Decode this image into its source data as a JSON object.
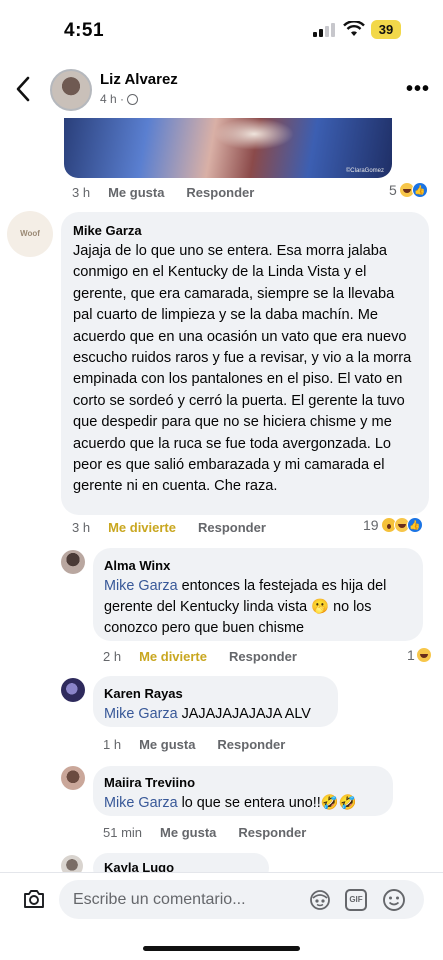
{
  "status_bar": {
    "time": "4:51",
    "battery": "39"
  },
  "header": {
    "name": "Liz Alvarez",
    "meta": "4 h ·"
  },
  "top_comment": {
    "image_credit": "©ClaraGomez",
    "time": "3 h",
    "like": "Me gusta",
    "reply": "Responder",
    "reaction_count": "5"
  },
  "main_comment": {
    "avatar_text": "Woof",
    "name": "Mike Garza",
    "text": "Jajaja de lo que uno se entera. Esa morra jalaba conmigo en el Kentucky de la Linda Vista y el gerente, que era camarada, siempre se la llevaba pal cuarto de limpieza y se la daba machín. Me acuerdo que en una ocasión un vato que era nuevo escucho ruidos raros y fue a revisar, y vio a la morra empinada con los pantalones en el piso. El vato en corto se sordeó y cerró la puerta. El gerente la tuvo que despedir para que no se hiciera chisme y me acuerdo que la ruca se fue toda avergonzada. Lo peor es que salió embarazada y mi camarada el gerente ni en cuenta. Che raza.",
    "time": "3 h",
    "reaction": "Me divierte",
    "reply": "Responder",
    "reaction_count": "19"
  },
  "replies": [
    {
      "name": "Alma Winx",
      "mention": "Mike Garza",
      "text": " entonces la festejada es hija del gerente del Kentucky linda vista 🫢 no los conozco pero que buen chisme",
      "time": "2 h",
      "reaction": "Me divierte",
      "reply": "Responder",
      "reaction_count": "1"
    },
    {
      "name": "Karen Rayas",
      "mention": "Mike Garza",
      "text": " JAJAJAJAJAJA ALV",
      "time": "1 h",
      "reaction": "Me gusta",
      "reply": "Responder"
    },
    {
      "name": "Maiira Treviino",
      "mention": "Mike Garza",
      "text": " lo que se entera uno!!🤣🤣",
      "time": "51 min",
      "reaction": "Me gusta",
      "reply": "Responder"
    },
    {
      "name": "Kayla Lugo"
    }
  ],
  "composer": {
    "placeholder": "Escribe un comentario...",
    "gif_label": "GIF"
  },
  "icons": {
    "back": "chevron-left-icon",
    "more": "more-icon",
    "camera": "camera-icon",
    "avatar_sticker": "avatar-sticker-icon",
    "gif": "gif-icon",
    "emoji": "emoji-icon"
  },
  "colors": {
    "mention": "#385898",
    "reacted": "#c9a720",
    "bubble": "#f0f2f5",
    "like_blue": "#1b74e4"
  }
}
